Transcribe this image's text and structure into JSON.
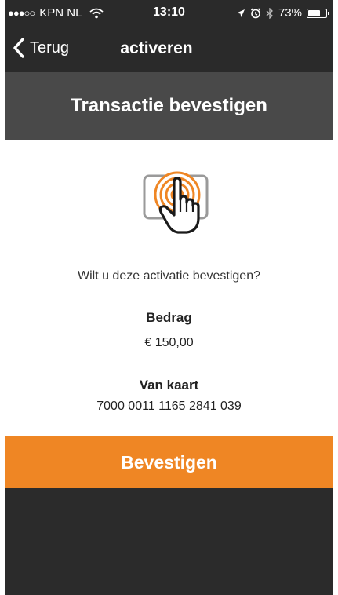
{
  "status_bar": {
    "signal": "●●●○○",
    "carrier": "KPN NL",
    "time": "13:10",
    "battery_percent": "73%",
    "battery_level": 0.73
  },
  "nav": {
    "back_label": "Terug",
    "title": "activeren"
  },
  "header": {
    "title": "Transactie bevestigen"
  },
  "content": {
    "question": "Wilt u deze activatie bevestigen?",
    "amount_label": "Bedrag",
    "amount_value": "€ 150,00",
    "card_label": "Van kaart",
    "card_value": "7000 0011 1165 2841 039"
  },
  "actions": {
    "confirm_label": "Bevestigen"
  },
  "colors": {
    "accent": "#ef8624",
    "nav_background": "#2a2a2a",
    "header_background": "#494949"
  },
  "icons": {
    "wifi": "wifi-icon",
    "location": "location-arrow-icon",
    "alarm": "alarm-icon",
    "bluetooth": "bluetooth-icon",
    "battery": "battery-icon",
    "back": "chevron-left-icon",
    "main": "fingerprint-touch-icon"
  }
}
